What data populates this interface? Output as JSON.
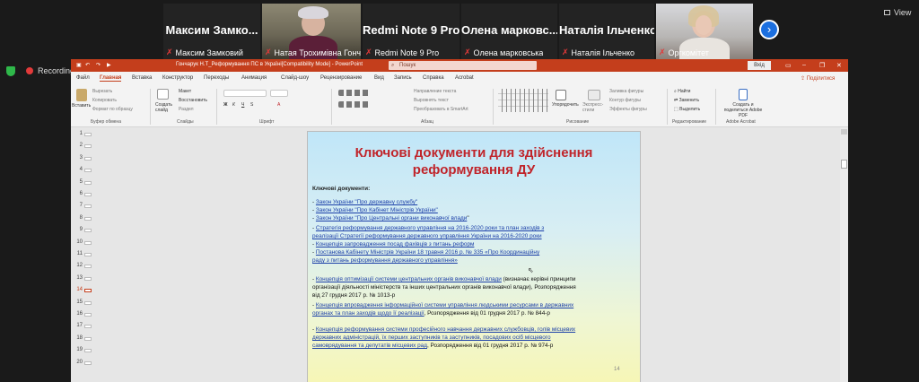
{
  "participants": [
    {
      "name": "Максим Замко...",
      "label": "Максим Замковий",
      "video": false
    },
    {
      "name": "",
      "label": "Натая Трохимівна Гонча...",
      "video": true
    },
    {
      "name": "Redmi Note 9 Pro",
      "label": "Redmi Note 9 Pro",
      "video": false
    },
    {
      "name": "Олена марковс...",
      "label": "Олена марковська",
      "video": false
    },
    {
      "name": "Наталія Ільченко",
      "label": "Наталія Ільченко",
      "video": false
    },
    {
      "name": "",
      "label": "Оргкомітет",
      "video": true
    }
  ],
  "view_label": "View",
  "recording_label": "Recording",
  "ppt": {
    "title": "Гончарук Н.Т_Реформування ПС в Україні[Compatibility Mode] - PowerPoint",
    "search_placeholder": "Пошук",
    "signin": "Вхід",
    "share": "Поділитися",
    "menu": [
      "Файл",
      "Главная",
      "Вставка",
      "Конструктор",
      "Переходы",
      "Анимация",
      "Слайд-шоу",
      "Рецензирование",
      "Вид",
      "Запись",
      "Справка",
      "Acrobat"
    ],
    "active_menu": "Главная",
    "ribbon": {
      "paste": "Вставить",
      "cut": "Вырезать",
      "copy": "Копировать",
      "format_painter": "Формат по образцу",
      "clipboard": "Буфер обмена",
      "new_slide": "Создать слайд",
      "layout": "Макет",
      "reset": "Восстановить",
      "section": "Раздел",
      "slides": "Слайды",
      "font": "Шрифт",
      "text_direction": "Направление текста",
      "align_text": "Выровнять текст",
      "smartart": "Преобразовать в SmartArt",
      "paragraph": "Абзац",
      "arrange": "Упорядочить",
      "quick_styles": "Экспресс-стили",
      "shape_fill": "Заливка фигуры",
      "shape_outline": "Контур фигуры",
      "shape_effects": "Эффекты фигуры",
      "drawing": "Рисование",
      "find": "Найти",
      "replace": "Заменить",
      "select": "Выделить",
      "editing": "Редактирование",
      "create_pdf": "Создать и поделиться Adobe PDF",
      "adobe": "Adobe Acrobat"
    },
    "thumb_numbers": [
      "1",
      "2",
      "3",
      "4",
      "5",
      "6",
      "7",
      "8",
      "9",
      "10",
      "11",
      "12",
      "13",
      "14",
      "15",
      "16",
      "17",
      "18",
      "19",
      "20"
    ],
    "selected_slide": "14",
    "slide": {
      "title_line1": "Ключові документи для здійснення",
      "title_line2": "реформування ДУ",
      "heading": "Ключові документи:",
      "lines": [
        {
          "parts": [
            [
              "t",
              "- "
            ],
            [
              "l",
              "Закон України \"Про державну службу\""
            ]
          ]
        },
        {
          "parts": [
            [
              "t",
              "- "
            ],
            [
              "l",
              "Закон України \"Про Кабінет Міністрів України\""
            ]
          ]
        },
        {
          "parts": [
            [
              "t",
              "- "
            ],
            [
              "l",
              "Закон України \"Про Центральні органи виконавчої влади"
            ],
            [
              "t",
              "\""
            ]
          ]
        },
        {
          "parts": [
            [
              "t",
              "- "
            ],
            [
              "l",
              "Стратегія реформування державного управління на 2016-2020 роки та план заходів з"
            ]
          ]
        },
        {
          "parts": [
            [
              "l",
              "реалізації Стратегії реформування державного управління України на 2016-2020 роки"
            ]
          ]
        },
        {
          "parts": [
            [
              "t",
              "- "
            ],
            [
              "l",
              "Концепція запровадження посад фахівців з питань реформ"
            ]
          ]
        },
        {
          "parts": [
            [
              "t",
              "- "
            ],
            [
              "l",
              "Постанова Кабінету Міністрів України 18 травня 2016 р. № 335 «Про Координаційну"
            ]
          ]
        },
        {
          "parts": [
            [
              "l",
              "раду з питань реформування державного управління»"
            ]
          ]
        },
        {
          "parts": [
            [
              "t",
              "- "
            ],
            [
              "l",
              "Концепція оптимізації системи центральних органів виконавчої влади"
            ],
            [
              "t",
              " (визначає керівні принципи"
            ]
          ]
        },
        {
          "parts": [
            [
              "t",
              "організації діяльності міністерств та інших центральних органів виконавчої влади), Розпорядження"
            ]
          ]
        },
        {
          "parts": [
            [
              "t",
              "від 27 грудня 2017 р. № 1013-р"
            ]
          ]
        },
        {
          "parts": [
            [
              "t",
              "- "
            ],
            [
              "l",
              "Концепція впровадження інформаційної системи управління людськими ресурсами в державних"
            ]
          ]
        },
        {
          "parts": [
            [
              "l",
              "органах та план заходів щодо її реалізації"
            ],
            [
              "t",
              ", Розпорядження від 01 грудня 2017 р. № 844-р"
            ]
          ]
        },
        {
          "parts": [
            [
              "t",
              "- "
            ],
            [
              "l",
              "Концепція реформування системи професійного навчання державних службовців, голів місцевих"
            ]
          ]
        },
        {
          "parts": [
            [
              "l",
              "державних адміністрацій, їх перших заступників та заступників, посадових осіб місцевого"
            ]
          ]
        },
        {
          "parts": [
            [
              "l",
              "самоврядування та депутатів місцевих рад"
            ],
            [
              "t",
              ", Розпорядження від 01 грудня 2017 р. № 974-р"
            ]
          ]
        }
      ],
      "page_number": "14"
    }
  }
}
